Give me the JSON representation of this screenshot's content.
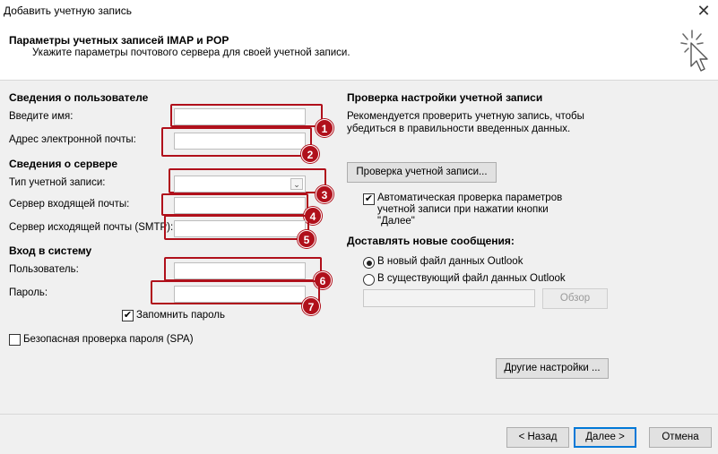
{
  "window": {
    "title": "Добавить учетную запись",
    "close_glyph": "✕"
  },
  "header": {
    "title": "Параметры учетных записей IMAP и POP",
    "subtitle": "Укажите параметры почтового сервера для своей учетной записи."
  },
  "user_info": {
    "heading": "Сведения о пользователе",
    "name_label": "Введите имя:",
    "name_value": "",
    "email_label": "Адрес электронной почты:",
    "email_value": ""
  },
  "server_info": {
    "heading": "Сведения о сервере",
    "account_type_label": "Тип учетной записи:",
    "account_type_value": "",
    "incoming_label": "Сервер входящей почты:",
    "incoming_value": "",
    "outgoing_label": "Сервер исходящей почты (SMTP):",
    "outgoing_value": ""
  },
  "login": {
    "heading": "Вход в систему",
    "user_label": "Пользователь:",
    "user_value": "",
    "password_label": "Пароль:",
    "password_value": "",
    "remember_label": "Запомнить пароль",
    "remember_checked": true,
    "spa_label": "Безопасная проверка пароля (SPA)",
    "spa_checked": false
  },
  "test": {
    "heading": "Проверка настройки учетной записи",
    "description_line1": "Рекомендуется проверить учетную запись, чтобы",
    "description_line2": "убедиться в правильности введенных данных.",
    "test_button": "Проверка учетной записи...",
    "auto_line1": "Автоматическая проверка параметров",
    "auto_line2": "учетной записи при нажатии кнопки",
    "auto_line3": "\"Далее\"",
    "auto_checked": true
  },
  "delivery": {
    "heading": "Доставлять новые сообщения:",
    "option_new": "В новый файл данных Outlook",
    "option_existing": "В существующий файл данных Outlook",
    "selected": "new",
    "browse_button": "Обзор",
    "path_value": ""
  },
  "more_settings_button": "Другие настройки ...",
  "footer": {
    "back": "< Назад",
    "next": "Далее >",
    "cancel": "Отмена"
  },
  "badges": [
    "1",
    "2",
    "3",
    "4",
    "5",
    "6",
    "7"
  ],
  "colors": {
    "highlight": "#b0101b",
    "primary_border": "#0078d7"
  },
  "icons": {
    "wizard": "cursor-click-icon",
    "dropdown": "chevron-down-icon",
    "check": "check-icon"
  }
}
